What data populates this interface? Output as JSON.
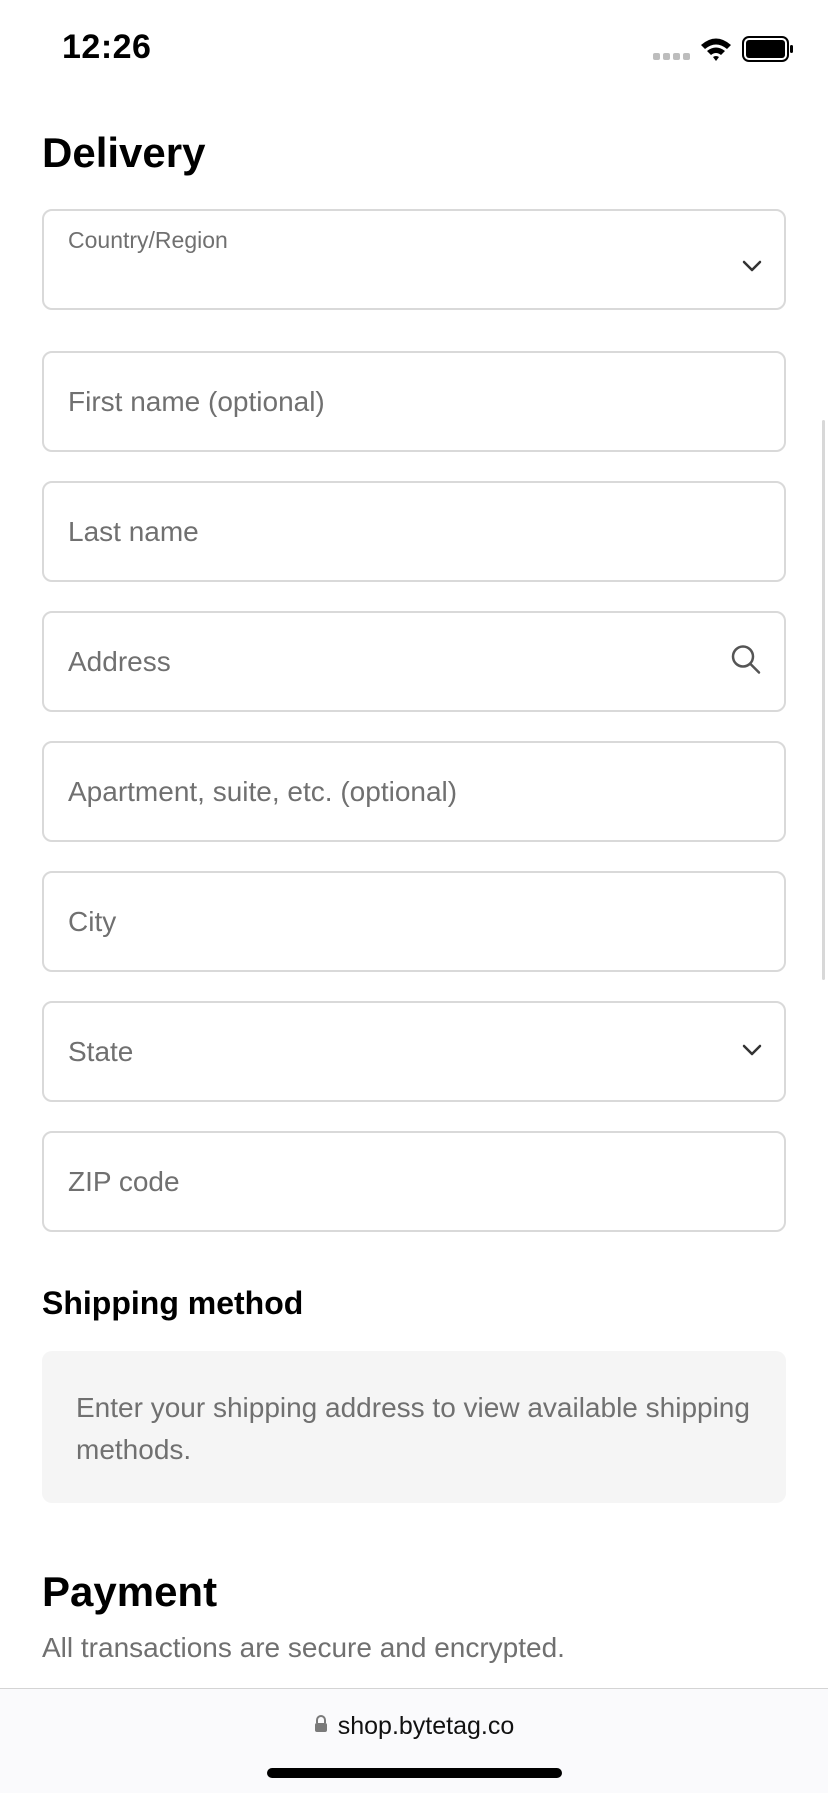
{
  "status_bar": {
    "time": "12:26"
  },
  "delivery": {
    "title": "Delivery",
    "fields": {
      "country_region": "Country/Region",
      "first_name": "First name (optional)",
      "last_name": "Last name",
      "address": "Address",
      "apartment": "Apartment, suite, etc. (optional)",
      "city": "City",
      "state": "State",
      "zip": "ZIP code"
    }
  },
  "shipping": {
    "title": "Shipping method",
    "notice": "Enter your shipping address to view available shipping methods."
  },
  "payment": {
    "title": "Payment",
    "subtitle": "All transactions are secure and encrypted."
  },
  "browser": {
    "url": "shop.bytetag.co"
  },
  "icons": {
    "country_chevron": "chevron-down-icon",
    "address_search": "search-icon",
    "state_chevron": "chevron-down-icon",
    "url_lock": "lock-icon",
    "signal": "cellular-signal-icon",
    "wifi": "wifi-icon",
    "battery": "battery-icon"
  },
  "colors": {
    "placeholder_text": "#707070",
    "border": "#d9d9d9",
    "notice_bg": "#f5f5f5"
  }
}
